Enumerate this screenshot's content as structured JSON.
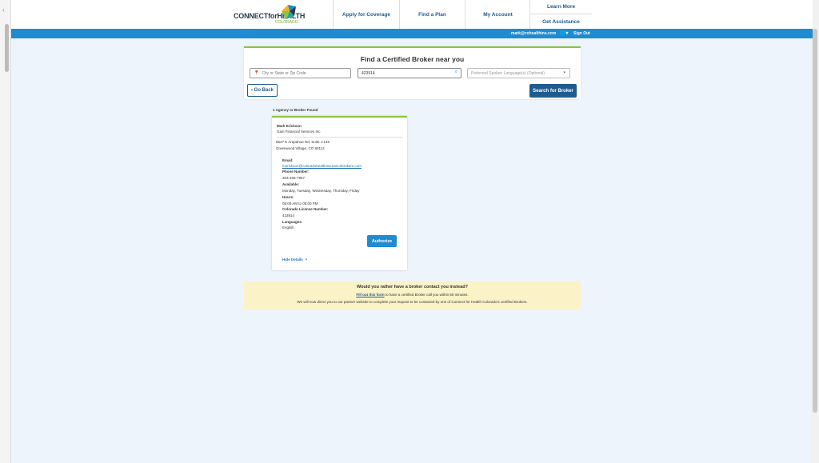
{
  "header": {
    "logo": {
      "brand_text": "CONNECTforHEALTH",
      "sub_text": "COLORADO"
    },
    "nav": {
      "apply": "Apply for Coverage",
      "find_plan": "Find a Plan",
      "my_account": "My Account",
      "learn_more": "Learn More",
      "get_assistance": "Get Assistance"
    }
  },
  "user_bar": {
    "email": "mark@cohealthins.com",
    "globe_icon": "globe-icon",
    "dropdown_glyph": "▾",
    "sign_out": "Sign Out"
  },
  "search": {
    "title": "Find a Certified Broker near you",
    "city_placeholder": "City or State or Zip Code",
    "license_value": "423914",
    "language_placeholder": "Preferred Spoken Language(s) (Optional)",
    "back_label": "Go Back",
    "search_label": "Search for Broker"
  },
  "results": {
    "count_text": "1 Agency or Broker Found",
    "broker": {
      "name": "Mark Erickson",
      "agency": "Gain Financial Services Inc",
      "address_line1": "8547 E Arapahoe Rd, Suite J-146",
      "address_line2": "Greenwood Village, CO 80112",
      "email_label": "Email:",
      "email": "merickson@coloradohealthinsurancebrokers.com",
      "phone_label": "Phone Number:",
      "phone": "303-456-7967",
      "available_label": "Available:",
      "available": "Monday, Tuesday, Wednesday, Thursday, Friday",
      "hours_label": "Hours:",
      "hours": "08:00 AM to 05:00 PM",
      "license_label": "Colorado License Number:",
      "license": "423914",
      "languages_label": "Languages:",
      "languages": "English",
      "authorize_label": "Authorize",
      "hide_details_label": "Hide Details"
    }
  },
  "contact_box": {
    "question": "Would you rather have a broker contact you instead?",
    "form_link": "Fill out this form",
    "form_suffix": " to have a certified Broker call you within 60 minutes.",
    "redirect_note": "We will now direct you to our partner website to complete your request to be contacted by one of Connect for Health Colorado's certified Brokers."
  },
  "colors": {
    "accent_blue": "#1f8bd0",
    "navy": "#1f5b8e",
    "green_rule": "#8cc63f",
    "notice_bg": "#fbf3c8"
  }
}
